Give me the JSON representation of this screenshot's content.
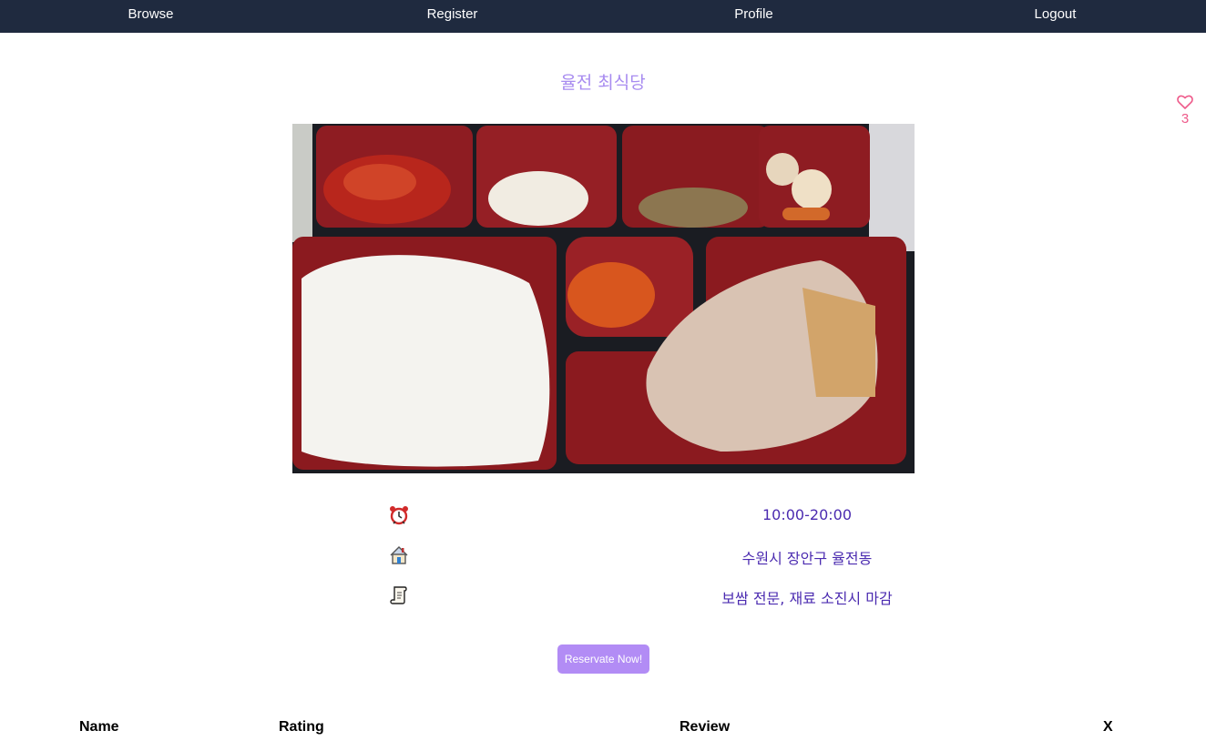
{
  "nav": {
    "browse": "Browse",
    "register": "Register",
    "profile": "Profile",
    "logout": "Logout"
  },
  "restaurant": {
    "name": "율전 최식당",
    "likes": "3",
    "hours": "10:00-20:00",
    "address": "수원시 장안구 율전동",
    "note": "보쌈 전문, 재료 소진시 마감"
  },
  "icons": {
    "like": "heart-icon",
    "hours": "alarm-clock-icon",
    "address": "house-icon",
    "note": "scroll-icon"
  },
  "actions": {
    "reserve": "Reservate Now!"
  },
  "reviews": {
    "columns": [
      "Name",
      "Rating",
      "Review",
      "X"
    ]
  },
  "colors": {
    "nav_bg": "#1f2a3f",
    "title": "#a88cf0",
    "info_text": "#4b2bb0",
    "button": "#b28cf5",
    "like": "#ee5a8a"
  }
}
